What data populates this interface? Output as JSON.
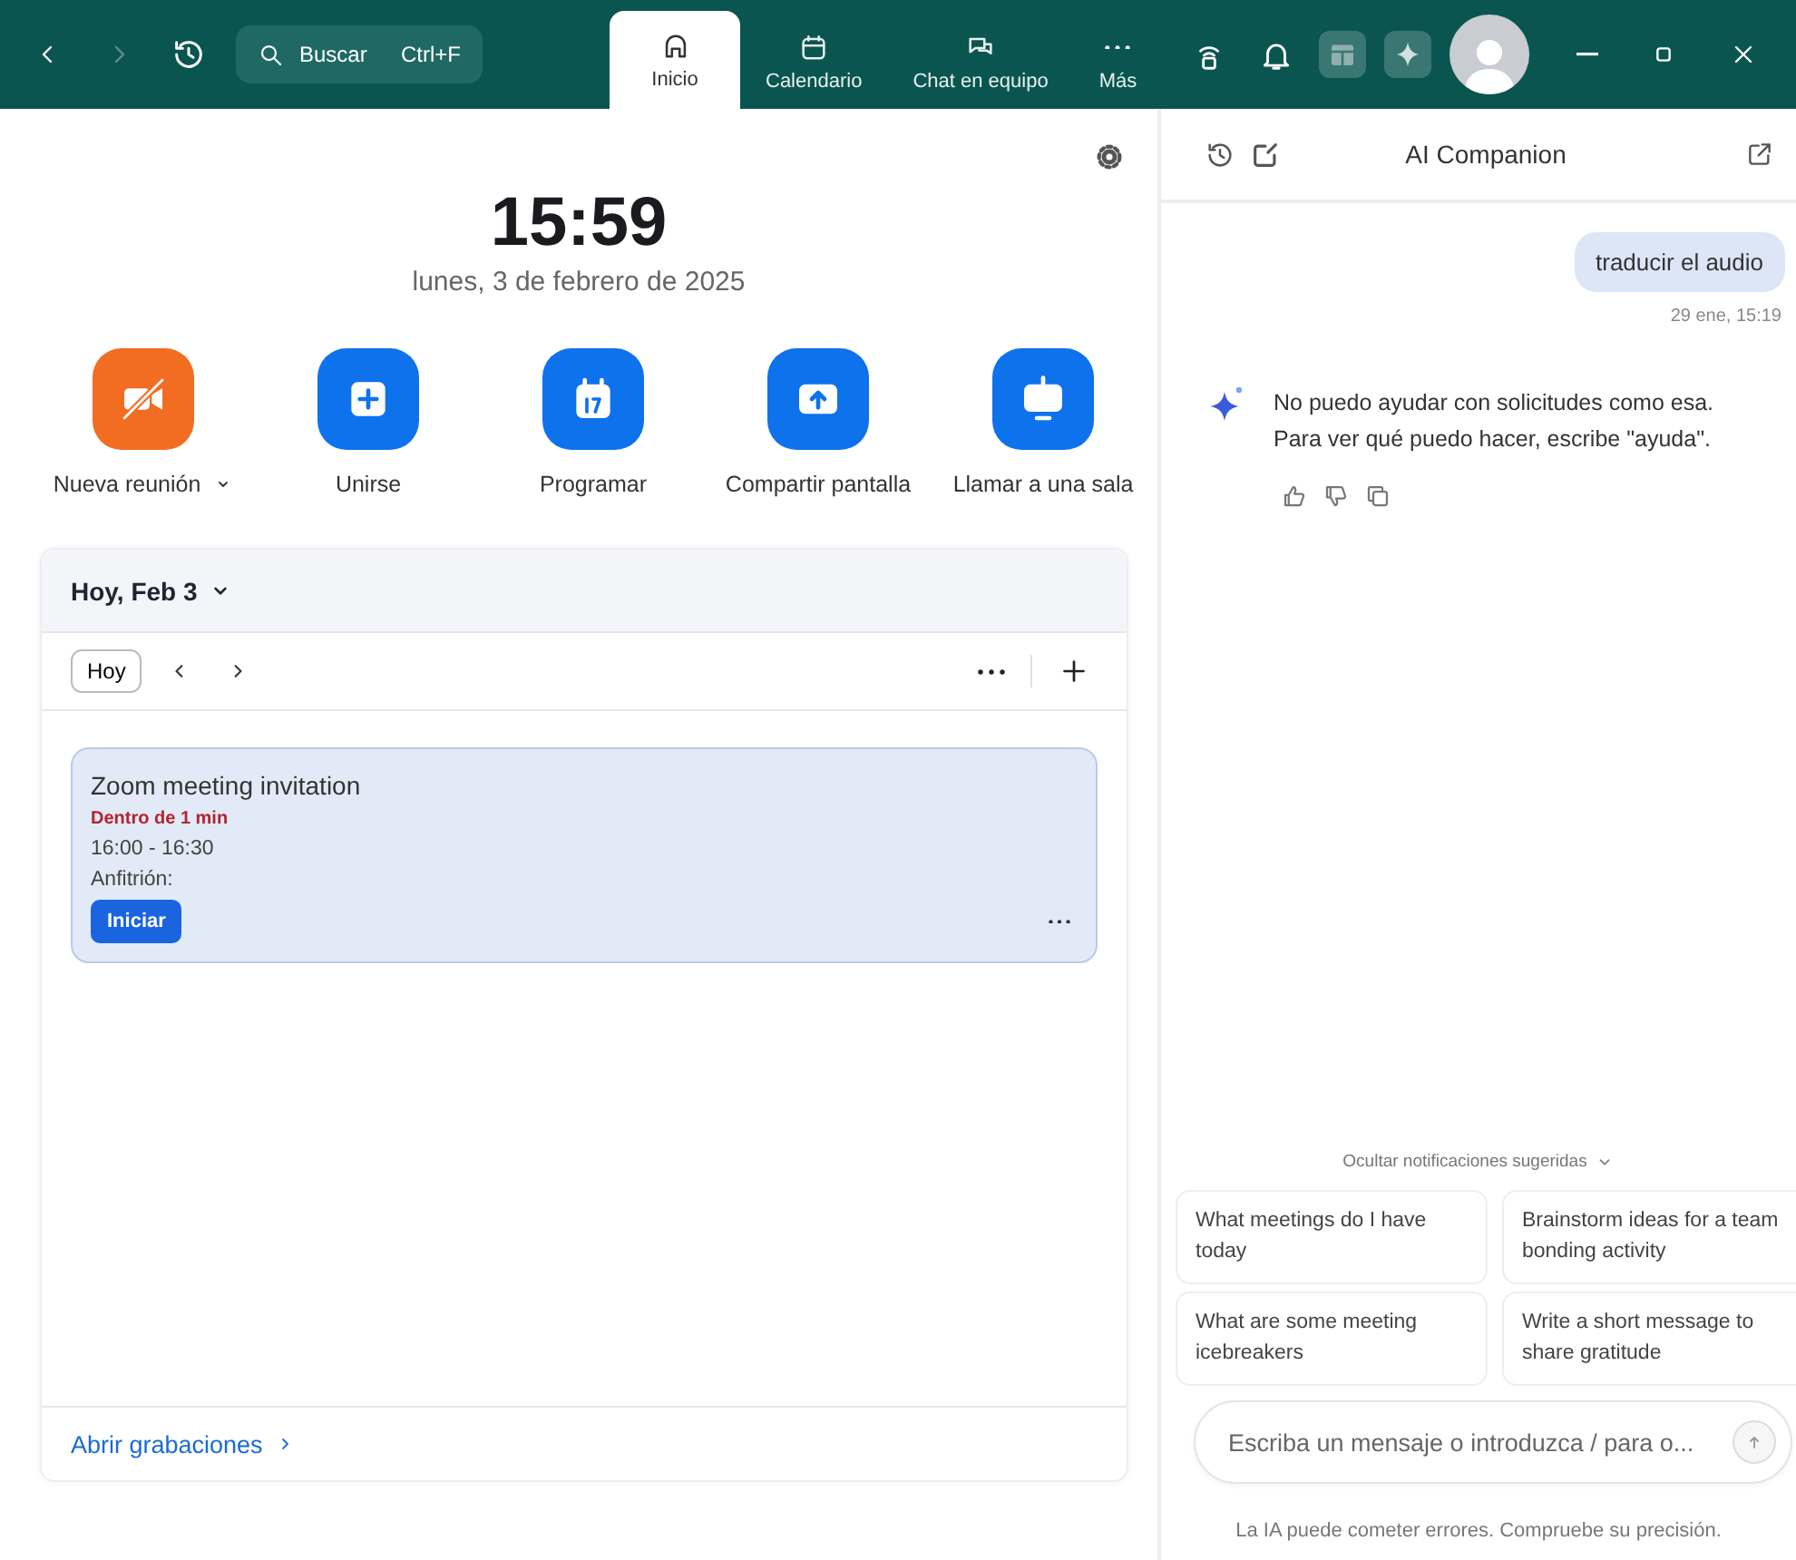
{
  "topbar": {
    "search": {
      "placeholder": "Buscar",
      "shortcut": "Ctrl+F"
    },
    "tabs": [
      {
        "label": "Inicio",
        "selected": true
      },
      {
        "label": "Calendario",
        "selected": false
      },
      {
        "label": "Chat en equipo",
        "selected": false
      },
      {
        "label": "Más",
        "selected": false
      }
    ]
  },
  "home": {
    "time": "15:59",
    "date": "lunes, 3 de febrero de 2025",
    "actions": [
      {
        "label": "Nueva reunión",
        "color": "#f26d21",
        "dropdown": true
      },
      {
        "label": "Unirse",
        "color": "#0e72ed",
        "dropdown": false
      },
      {
        "label": "Programar",
        "color": "#0e72ed",
        "dropdown": false
      },
      {
        "label": "Compartir pantalla",
        "color": "#0e72ed",
        "dropdown": false
      },
      {
        "label": "Llamar a una sala",
        "color": "#0e72ed",
        "dropdown": false
      }
    ],
    "calendar": {
      "title": "Hoy, Feb 3",
      "today_button": "Hoy",
      "meetings": [
        {
          "title": "Zoom meeting invitation",
          "status": "Dentro de 1 min",
          "time": "16:00 - 16:30",
          "host_label": "Anfitrión:",
          "button": "Iniciar"
        }
      ],
      "footer_link": "Abrir grabaciones"
    }
  },
  "companion": {
    "title": "AI Companion",
    "messages": [
      {
        "kind": "user",
        "text": "traducir el audio",
        "time": "29 ene, 15:19"
      },
      {
        "kind": "ai",
        "text": "No puedo ayudar con solicitudes como esa.\nPara ver qué puedo hacer, escribe \"ayuda\"."
      }
    ],
    "suggestions_toggle": "Ocultar notificaciones sugeridas",
    "suggestions": [
      "What meetings do I have today",
      "Brainstorm ideas for a team bonding activity",
      "What are some meeting icebreakers",
      "Write a short message to share gratitude"
    ],
    "input": {
      "placeholder": "Escriba un mensaje o introduzca / para o..."
    },
    "disclaimer": "La IA puede cometer errores. Compruebe su precisión."
  }
}
